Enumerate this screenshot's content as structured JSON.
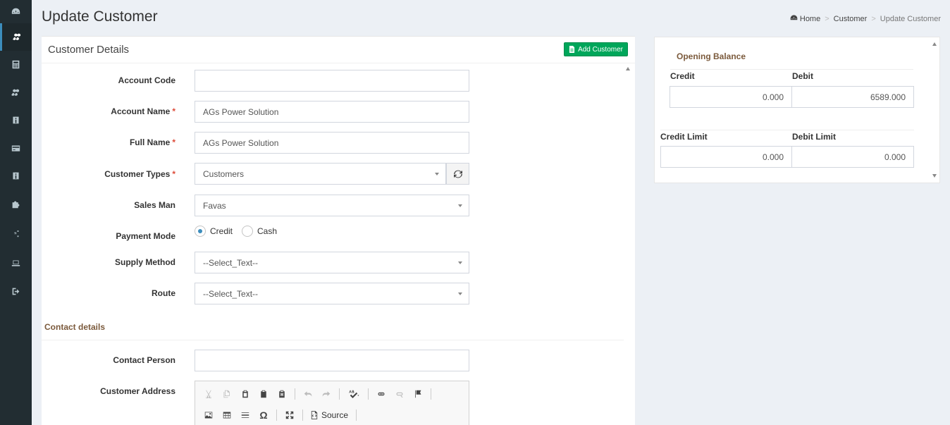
{
  "page": {
    "title": "Update Customer"
  },
  "breadcrumb": {
    "home": "Home",
    "level1": "Customer",
    "current": "Update Customer",
    "separator": ">"
  },
  "sidebar": {
    "icons": [
      "dashboard-icon",
      "cubes-icon",
      "calculator-icon",
      "cubes-icon",
      "info-icon",
      "credit-card-icon",
      "info-icon",
      "puzzle-icon",
      "cogs-icon",
      "laptop-icon",
      "sign-out-icon"
    ],
    "active_index": 1
  },
  "customer_panel": {
    "title": "Customer Details",
    "add_button": "Add Customer",
    "fields": {
      "account_code": {
        "label": "Account Code",
        "value": ""
      },
      "account_name": {
        "label": "Account Name",
        "value": "AGs Power Solution",
        "required": "*"
      },
      "full_name": {
        "label": "Full Name",
        "value": "AGs Power Solution",
        "required": "*"
      },
      "customer_types": {
        "label": "Customer Types",
        "value": "Customers",
        "required": "*"
      },
      "sales_man": {
        "label": "Sales Man",
        "value": "Favas"
      },
      "payment_mode": {
        "label": "Payment Mode",
        "options": [
          "Credit",
          "Cash"
        ],
        "selected": "Credit"
      },
      "supply_method": {
        "label": "Supply Method",
        "value": "--Select_Text--"
      },
      "route": {
        "label": "Route",
        "value": "--Select_Text--"
      }
    },
    "contact_section": {
      "title": "Contact details",
      "contact_person": {
        "label": "Contact Person",
        "value": ""
      },
      "customer_address": {
        "label": "Customer Address"
      }
    },
    "editor_toolbar": {
      "row1": [
        "cut-icon",
        "copy-icon",
        "paste-icon",
        "paste-text-icon",
        "paste-word-icon",
        "undo-icon",
        "redo-icon",
        "spellcheck-icon",
        "link-icon",
        "unlink-icon",
        "anchor-flag-icon"
      ],
      "row2": [
        "image-icon",
        "table-icon",
        "horizontal-rule-icon",
        "special-char-icon",
        "maximize-icon"
      ],
      "source_label": "Source"
    }
  },
  "balance_panel": {
    "opening_title": "Opening Balance",
    "credit_label": "Credit",
    "debit_label": "Debit",
    "credit_value": "0.000",
    "debit_value": "6589.000",
    "credit_limit_label": "Credit Limit",
    "debit_limit_label": "Debit Limit",
    "credit_limit_value": "0.000",
    "debit_limit_value": "0.000"
  },
  "colors": {
    "sidebar": "#222d32",
    "accent": "#3c8dbc",
    "success": "#00a65a",
    "section_heading": "#7b5a3c",
    "required": "#dd4b39"
  }
}
